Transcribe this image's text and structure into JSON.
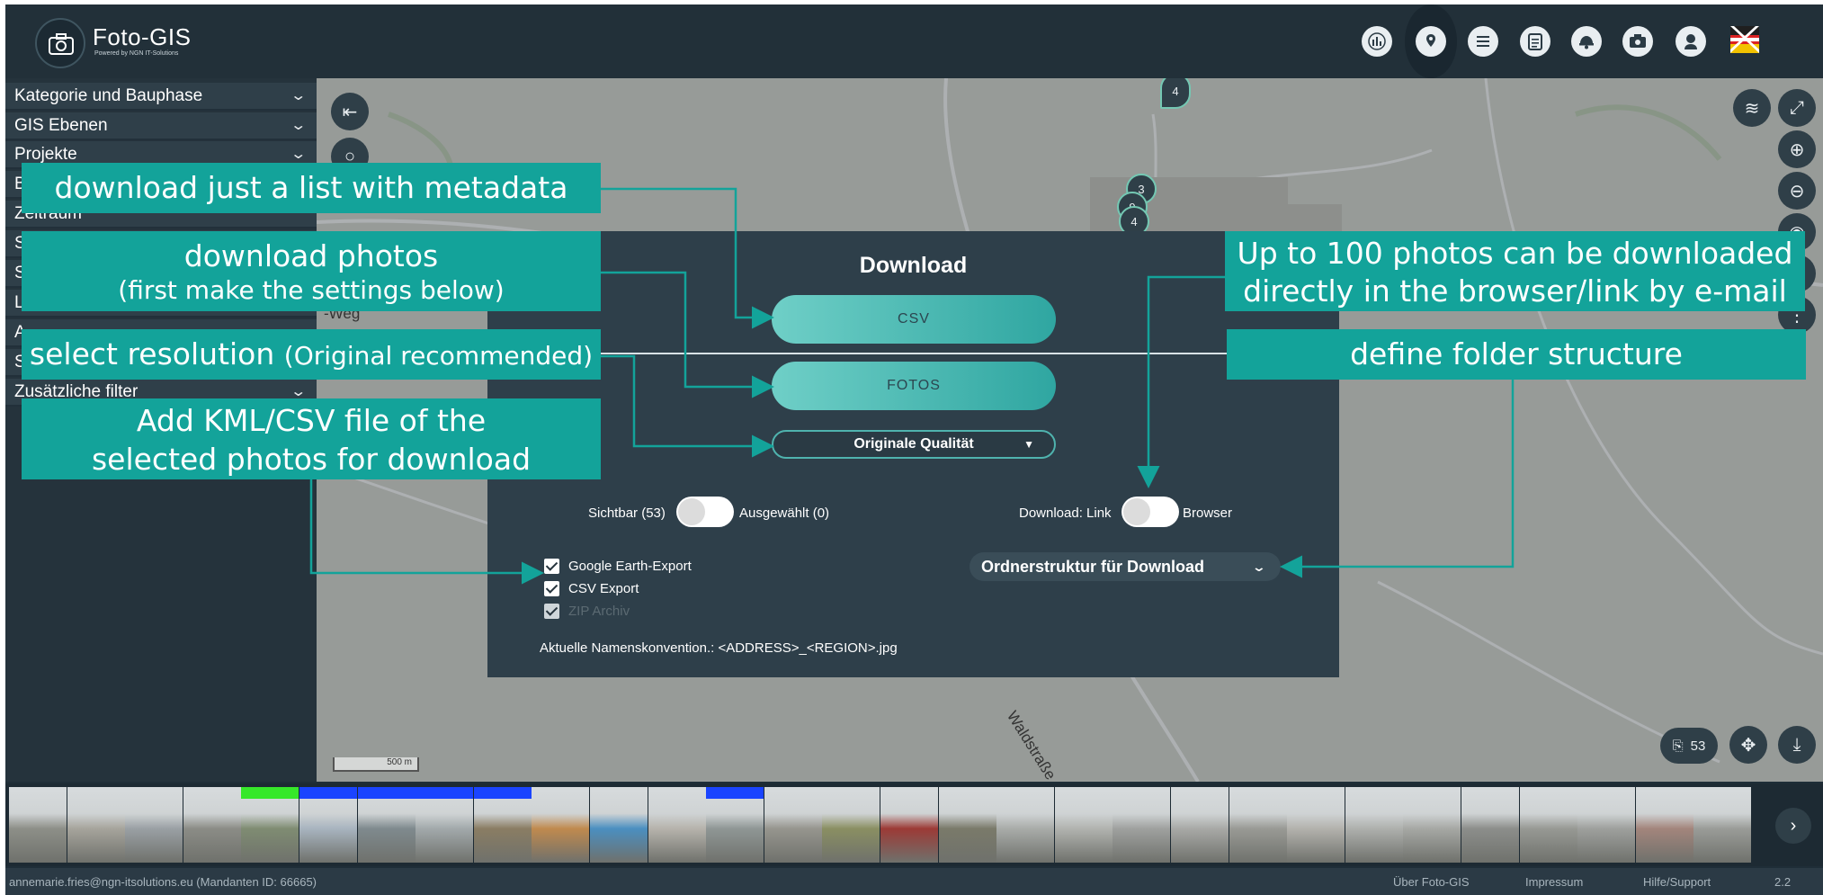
{
  "app": {
    "title": "Foto-GIS",
    "subtitle": "Powered by NGN IT-Solutions"
  },
  "header_icons": [
    "bar-chart-icon",
    "map-pin-icon",
    "layers-list-icon",
    "clipboard-icon",
    "helmet-icon",
    "camera-settings-icon",
    "user-icon",
    "flag-icon"
  ],
  "sidebar": {
    "items": [
      {
        "label": "Kategorie und Bauphase"
      },
      {
        "label": "GIS Ebenen"
      },
      {
        "label": "Projekte"
      },
      {
        "label": "B"
      },
      {
        "label": "Zeitraum"
      },
      {
        "label": "S"
      },
      {
        "label": "S"
      },
      {
        "label": "L"
      },
      {
        "label": "A"
      },
      {
        "label": "S"
      },
      {
        "label": "Zusätzliche filter"
      }
    ]
  },
  "map": {
    "street_weg": "-Weg",
    "street_wald": "Waldstraße",
    "scale": "500 m",
    "cluster_top": "4",
    "clusters": [
      "3",
      "9",
      "4"
    ],
    "photo_count": "53"
  },
  "dialog": {
    "title": "Download",
    "csv_button": "CSV",
    "fotos_button": "FOTOS",
    "quality": "Originale Qualität",
    "visible_label": "Sichtbar (53)",
    "selected_label": "Ausgewählt (0)",
    "download_link_label": "Download: Link",
    "browser_label": "Browser",
    "google_earth": "Google Earth-Export",
    "csv_export": "CSV Export",
    "zip_archiv": "ZIP Archiv",
    "folder_structure": "Ordnerstruktur für Download",
    "naming": "Aktuelle Namenskonvention.: <ADDRESS>_<REGION>.jpg"
  },
  "callouts": {
    "list_metadata": "download just a list with metadata",
    "photos_line1": "download photos",
    "photos_line2": "(first make the settings below)",
    "resolution_main": "select resolution",
    "resolution_note": "(Original recommended)",
    "kml_line1": "Add KML/CSV file of the",
    "kml_line2": "selected photos for download",
    "limit_line1": "Up to 100 photos can be downloaded",
    "limit_line2": "directly in the browser/link by e-mail",
    "folder": "define folder structure"
  },
  "filmstrip": {
    "bar_colors": [
      "",
      "",
      "",
      "",
      "#36e82a",
      "#1a44ff",
      "#1a44ff",
      "#1a44ff",
      "#1a44ff",
      "",
      "",
      "",
      "#1a44ff",
      "",
      "",
      "",
      "",
      "",
      "",
      "",
      "",
      "",
      "",
      "",
      "",
      "",
      "",
      "",
      "",
      ""
    ],
    "thumb_colors": [
      "#8d8f88",
      "#a6a49c",
      "#9aa0a4",
      "#8b8c86",
      "#7f8c72",
      "#a8b4bf",
      "#7f8a8e",
      "#a2a9ab",
      "#8a7d63",
      "#c08a4e",
      "#4b8fc0",
      "#b6b3ac",
      "#8f9695",
      "#96958e",
      "#8a8f62",
      "#9c3a36",
      "#7a7a6a",
      "#a9aca9",
      "#b1b3af",
      "#9fa19f",
      "#a8a9a6",
      "#999a95",
      "#b3b2ad",
      "#aeb0ad",
      "#a6a8a4",
      "#8c8e8b",
      "#979994",
      "#9ea09d",
      "#a3857c",
      "#9a9c98"
    ]
  },
  "footer": {
    "user": "annemarie.fries@ngn-itsolutions.eu (Mandanten ID: 66665)",
    "about": "Über Foto-GIS",
    "impressum": "Impressum",
    "help": "Hilfe/Support",
    "version": "2.2"
  },
  "colors": {
    "accent": "#13a39a",
    "bar": "#223039",
    "panel": "#2e3f4a"
  }
}
